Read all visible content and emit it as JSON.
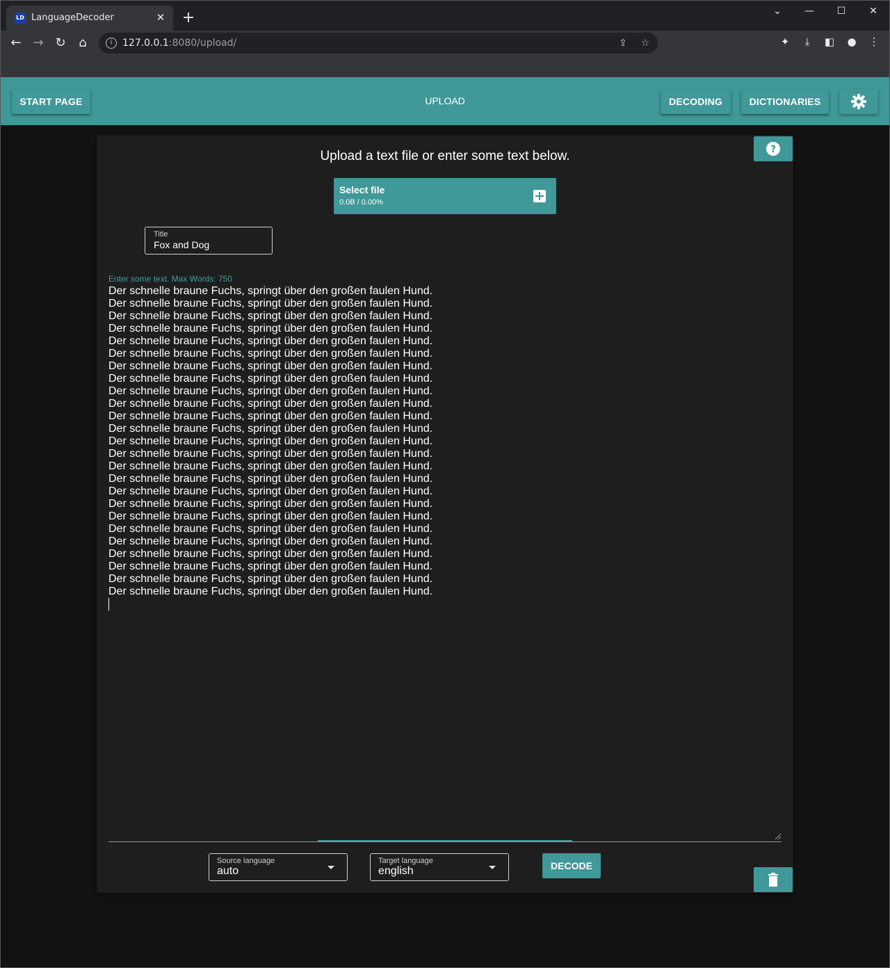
{
  "browser": {
    "tab_title": "LanguageDecoder",
    "tab_favicon": "LD",
    "tab_close": "✕",
    "new_tab": "+",
    "url_host": "127.0.0.1",
    "url_rest": ":8080/upload/"
  },
  "nav": {
    "start_page": "START PAGE",
    "title": "UPLOAD",
    "decoding": "DECODING",
    "dictionaries": "DICTIONARIES"
  },
  "upload": {
    "heading": "Upload a text file or enter some text below.",
    "select_file_label": "Select file",
    "progress": "0.0B / 0.00%"
  },
  "title_field": {
    "label": "Title",
    "value": "Fox and Dog"
  },
  "text_input": {
    "label": "Enter some text. Max Words: 750",
    "lines": [
      "Der schnelle braune Fuchs, springt über den großen faulen Hund.",
      "Der schnelle braune Fuchs, springt über den großen faulen Hund.",
      "Der schnelle braune Fuchs, springt über den großen faulen Hund.",
      "Der schnelle braune Fuchs, springt über den großen faulen Hund.",
      "Der schnelle braune Fuchs, springt über den großen faulen Hund.",
      "Der schnelle braune Fuchs, springt über den großen faulen Hund.",
      "Der schnelle braune Fuchs, springt über den großen faulen Hund.",
      "Der schnelle braune Fuchs, springt über den großen faulen Hund.",
      "Der schnelle braune Fuchs, springt über den großen faulen Hund.",
      "Der schnelle braune Fuchs, springt über den großen faulen Hund.",
      "Der schnelle braune Fuchs, springt über den großen faulen Hund.",
      "Der schnelle braune Fuchs, springt über den großen faulen Hund.",
      "Der schnelle braune Fuchs, springt über den großen faulen Hund.",
      "Der schnelle braune Fuchs, springt über den großen faulen Hund.",
      "Der schnelle braune Fuchs, springt über den großen faulen Hund.",
      "Der schnelle braune Fuchs, springt über den großen faulen Hund.",
      "Der schnelle braune Fuchs, springt über den großen faulen Hund.",
      "Der schnelle braune Fuchs, springt über den großen faulen Hund.",
      "Der schnelle braune Fuchs, springt über den großen faulen Hund.",
      "Der schnelle braune Fuchs, springt über den großen faulen Hund.",
      "Der schnelle braune Fuchs, springt über den großen faulen Hund.",
      "Der schnelle braune Fuchs, springt über den großen faulen Hund.",
      "Der schnelle braune Fuchs, springt über den großen faulen Hund.",
      "Der schnelle braune Fuchs, springt über den großen faulen Hund.",
      "Der schnelle braune Fuchs, springt über den großen faulen Hund."
    ]
  },
  "source_language": {
    "label": "Source language",
    "value": "auto"
  },
  "target_language": {
    "label": "Target language",
    "value": "english"
  },
  "actions": {
    "decode": "DECODE"
  },
  "colors": {
    "accent": "#409898",
    "card": "#1e1e1e",
    "background": "#121212"
  },
  "icons": [
    "back-icon",
    "forward-icon",
    "reload-icon",
    "home-icon",
    "info-icon",
    "share-icon",
    "star-icon",
    "extensions-icon",
    "download-icon",
    "sidepanel-icon",
    "profile-icon",
    "menu-icon",
    "gear-icon",
    "help-icon",
    "plus-icon",
    "trash-icon",
    "dropdown-arrow-icon"
  ]
}
